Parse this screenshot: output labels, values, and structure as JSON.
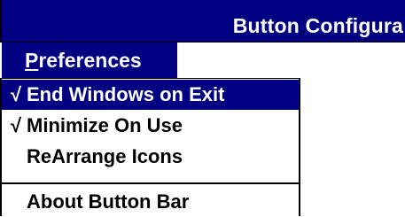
{
  "window": {
    "title": "Button Configura"
  },
  "menu": {
    "title_accel": "P",
    "title_rest": "references",
    "items": [
      {
        "label": "End Windows on Exit",
        "checked": true,
        "check_glyph": "√",
        "selected": true
      },
      {
        "label": "Minimize On Use",
        "checked": true,
        "check_glyph": "√",
        "selected": false
      },
      {
        "label": "ReArrange Icons",
        "checked": false,
        "check_glyph": "",
        "selected": false
      },
      {
        "label": "About Button Bar",
        "checked": false,
        "check_glyph": "",
        "selected": false
      }
    ]
  },
  "colors": {
    "highlight": "#000080",
    "background": "#ffffff",
    "text": "#000000"
  }
}
